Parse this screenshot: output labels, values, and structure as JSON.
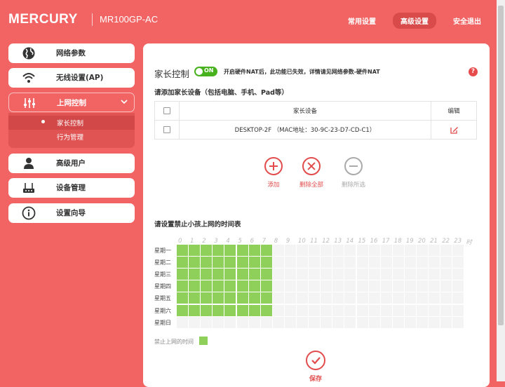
{
  "brand": "MERCURY",
  "model": "MR100GP-AC",
  "top_nav": [
    {
      "label": "常用设置",
      "active": false
    },
    {
      "label": "高级设置",
      "active": true
    },
    {
      "label": "安全退出",
      "active": false
    }
  ],
  "sidebar": {
    "items": [
      {
        "label": "网络参数",
        "icon": "globe-icon"
      },
      {
        "label": "无线设置(AP)",
        "icon": "wifi-icon"
      },
      {
        "label": "上网控制",
        "icon": "sliders-icon"
      },
      {
        "label": "高级用户",
        "icon": "user-icon"
      },
      {
        "label": "设备管理",
        "icon": "router-icon"
      },
      {
        "label": "设置向导",
        "icon": "info-icon"
      }
    ],
    "submenu": [
      {
        "label": "家长控制",
        "active": true
      },
      {
        "label": "行为管理",
        "active": false
      }
    ]
  },
  "main": {
    "title": "家长控制",
    "toggle_label": "ON",
    "hint": "开启硬件NAT后，此功能已失效，详情请见网络参数-硬件NAT",
    "help": "?",
    "add_section_title": "请添加家长设备（包括电脑、手机、Pad等）",
    "table": {
      "headers": [
        "家长设备",
        "编辑"
      ],
      "rows": [
        {
          "device": "DESKTOP-2F （MAC地址：30-9C-23-D7-CD-C1）"
        }
      ]
    },
    "actions": [
      {
        "label": "添加",
        "icon": "plus-icon",
        "color": "#e24c4c"
      },
      {
        "label": "删除全部",
        "icon": "close-icon",
        "color": "#e24c4c"
      },
      {
        "label": "删除所选",
        "icon": "minus-icon",
        "color": "#aaaaaa"
      }
    ],
    "schedule_title": "请设置禁止小孩上网的时间表",
    "hours": [
      "0",
      "1",
      "2",
      "3",
      "4",
      "5",
      "6",
      "7",
      "8",
      "9",
      "10",
      "11",
      "12",
      "13",
      "14",
      "15",
      "16",
      "17",
      "18",
      "19",
      "20",
      "21",
      "22",
      "23",
      "时"
    ],
    "days": [
      "星期一",
      "星期二",
      "星期三",
      "星期四",
      "星期五",
      "星期六",
      "星期日"
    ],
    "blocked_hours": {
      "星期一": [
        0,
        1,
        2,
        3,
        4,
        5,
        6,
        7
      ],
      "星期二": [
        0,
        1,
        2,
        3,
        4,
        5,
        6,
        7
      ],
      "星期三": [
        0,
        1,
        2,
        3,
        4,
        5,
        6,
        7
      ],
      "星期四": [
        0,
        1,
        2,
        3,
        4,
        5,
        6,
        7
      ],
      "星期五": [
        0,
        1,
        2,
        3,
        4,
        5,
        6,
        7
      ],
      "星期六": [
        0,
        1,
        2,
        3,
        4,
        5,
        6,
        7
      ],
      "星期日": []
    },
    "legend": "禁止上网的时间",
    "save_label": "保存"
  },
  "colors": {
    "accent": "#f26464",
    "blocked": "#8fd05a",
    "toggle_on": "#47b21e"
  }
}
